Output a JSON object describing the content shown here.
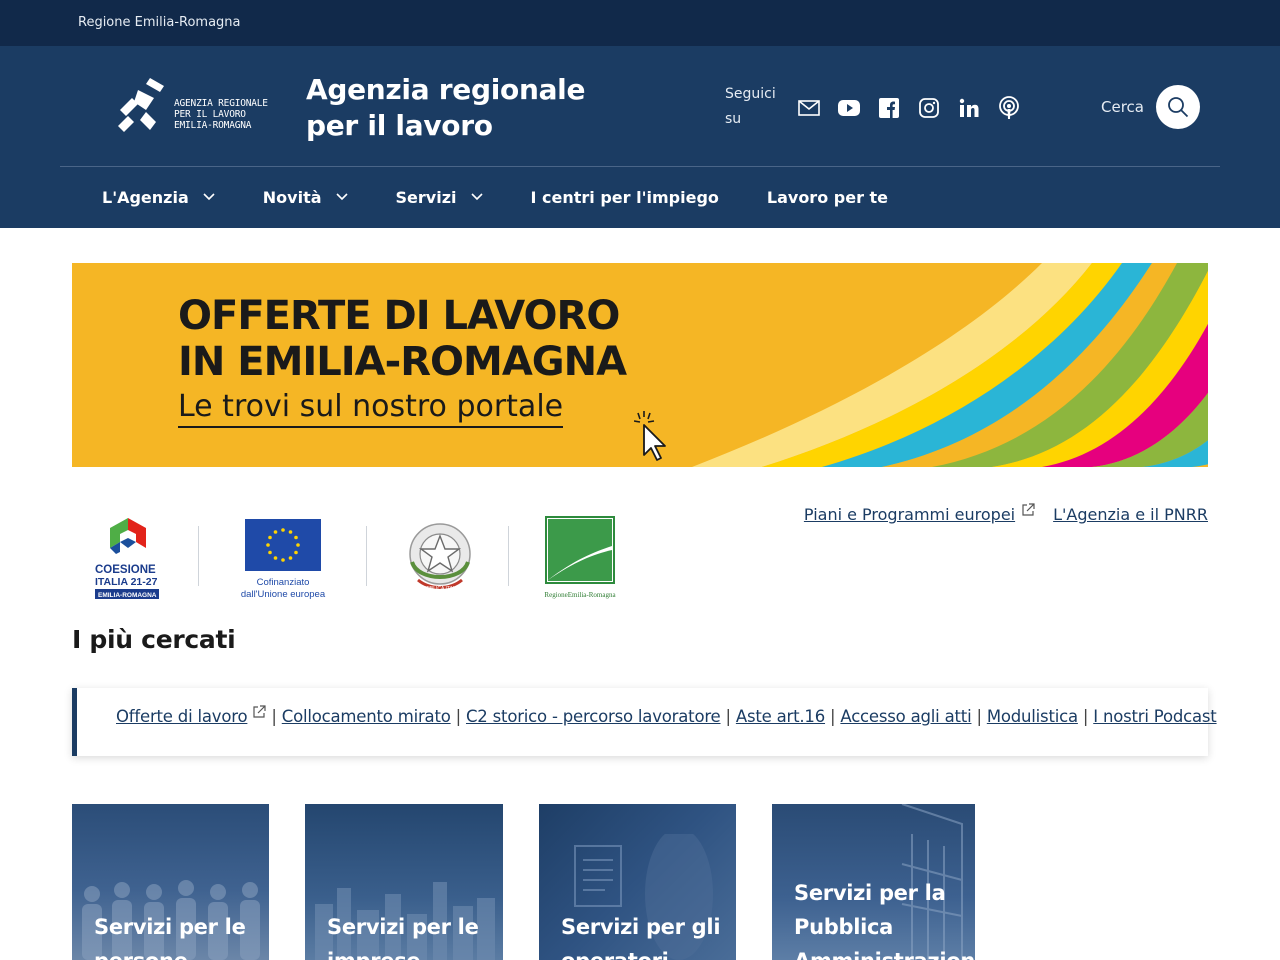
{
  "topbar": {
    "region": "Regione Emilia-Romagna"
  },
  "header": {
    "logo_lines": [
      "AGENZIA REGIONALE",
      "PER IL LAVORO",
      "EMILIA-ROMAGNA"
    ],
    "title": "Agenzia regionale per il lavoro",
    "follow_label": "Seguici su",
    "social_icons": [
      "mail-icon",
      "youtube-icon",
      "facebook-icon",
      "instagram-icon",
      "linkedin-icon",
      "podcast-icon"
    ],
    "search_label": "Cerca"
  },
  "nav": {
    "items": [
      {
        "label": "L'Agenzia",
        "dropdown": true
      },
      {
        "label": "Novità",
        "dropdown": true
      },
      {
        "label": "Servizi",
        "dropdown": true
      },
      {
        "label": "I centri per l'impiego",
        "dropdown": false
      },
      {
        "label": "Lavoro per te",
        "dropdown": false
      }
    ]
  },
  "banner": {
    "line1": "OFFERTE DI LAVORO",
    "line2": "IN EMILIA-ROMAGNA",
    "line3": "Le trovi sul nostro portale"
  },
  "funding_logos": {
    "coesione": [
      "COESIONE",
      "ITALIA 21-27",
      "EMILIA-ROMAGNA"
    ],
    "eu": [
      "Cofinanziato",
      "dall'Unione europea"
    ],
    "repubblica": "REPUBBLICA ITALIANA",
    "regione": "RegioneEmilia-Romagna"
  },
  "europe_links": {
    "piani": "Piani e Programmi europei",
    "pnrr": "L'Agenzia e il PNRR"
  },
  "most_searched": {
    "title": "I più cercati",
    "links": [
      {
        "label": "Offerte di lavoro",
        "external": true
      },
      {
        "label": "Collocamento mirato",
        "external": false
      },
      {
        "label": "C2 storico - percorso lavoratore",
        "external": false
      },
      {
        "label": "Aste art.16",
        "external": false
      },
      {
        "label": "Accesso agli atti",
        "external": false
      },
      {
        "label": "Modulistica",
        "external": false
      },
      {
        "label": "I nostri Podcast",
        "external": false
      }
    ],
    "separator": "|"
  },
  "cards": [
    {
      "label_lines": [
        "Servizi per le",
        "persone"
      ]
    },
    {
      "label_lines": [
        "Servizi per le",
        "imprese"
      ]
    },
    {
      "label_lines": [
        "Servizi per gli",
        "operatori"
      ]
    },
    {
      "label_lines": [
        "Servizi per la",
        "Pubblica",
        "Amministrazione"
      ]
    }
  ],
  "colors": {
    "topbar": "#11294a",
    "header": "#1b3c63",
    "banner_yellow": "#f5b625",
    "link": "#1b3c63"
  }
}
